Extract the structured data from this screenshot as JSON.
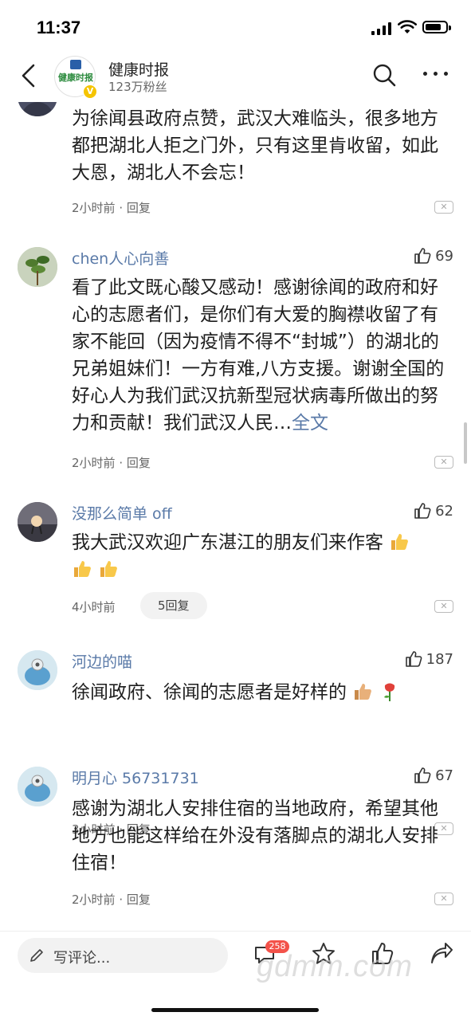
{
  "status_bar": {
    "time": "11:37"
  },
  "header": {
    "account_name": "健康时报",
    "fans": "123万粉丝",
    "logo_text": "健康时报",
    "verified": "V"
  },
  "comments": [
    {
      "user": "",
      "likes": "",
      "text": "为徐闻县政府点赞，武汉大难临头，很多地方都把湖北人拒之门外，只有这里肯收留，如此大恩，湖北人不会忘！",
      "time": "2小时前",
      "reply": "回复"
    },
    {
      "user": "chen人心向善",
      "likes": "69",
      "text": "看了此文既心酸又感动！感谢徐闻的政府和好心的志愿者们，是你们有大爱的胸襟收留了有家不能回（因为疫情不得不“封城”）的湖北的兄弟姐妹们！一方有难,八方支援。谢谢全国的好心人为我们武汉抗新型冠状病毒所做出的努力和贡献！我们武汉人民…",
      "more": "全文",
      "time": "2小时前",
      "reply": "回复"
    },
    {
      "user": "没那么简单 off",
      "likes": "62",
      "text": "我大武汉欢迎广东湛江的朋友们来作客",
      "time": "4小时前",
      "reply": "5回复"
    },
    {
      "user": "河边的喵",
      "likes": "187",
      "text": "徐闻政府、徐闻的志愿者是好样的",
      "time": "3小时前",
      "reply": "回复"
    },
    {
      "user": "明月心 56731731",
      "likes": "67",
      "text": "感谢为湖北人安排住宿的当地政府，希望其他地方也能这样给在外没有落脚点的湖北人安排住宿！",
      "time": "2小时前",
      "reply": "回复"
    }
  ],
  "bottom_bar": {
    "compose_placeholder": "写评论...",
    "comment_count": "258"
  },
  "watermark": "gdmm.com"
}
